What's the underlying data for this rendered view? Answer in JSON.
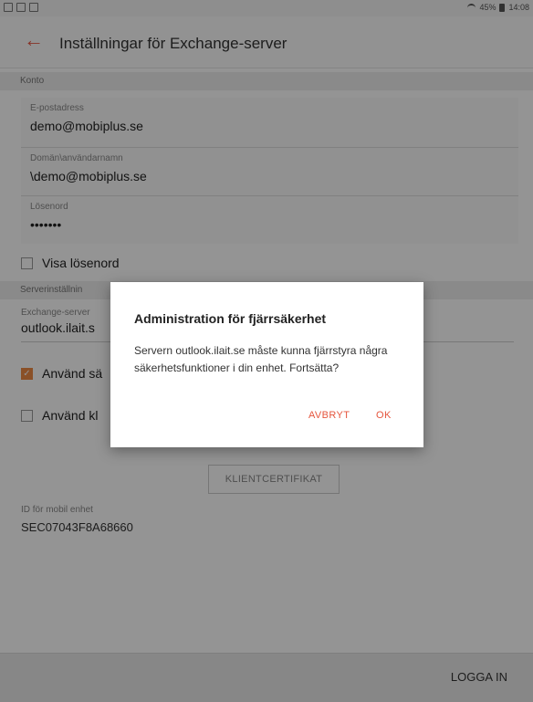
{
  "status_bar": {
    "right_text": "45%",
    "time": "14:08"
  },
  "app_bar": {
    "title": "Inställningar för Exchange-server"
  },
  "account": {
    "header": "Konto",
    "email": {
      "label": "E-postadress",
      "value": "demo@mobiplus.se"
    },
    "domain_user": {
      "label": "Domän\\användarnamn",
      "value": "\\demo@mobiplus.se"
    },
    "password": {
      "label": "Lösenord",
      "value": "•••••••"
    },
    "show_password_label": "Visa lösenord"
  },
  "server": {
    "header": "Serverinställnin",
    "exchange_label": "Exchange-server",
    "exchange_value": "outlook.ilait.s",
    "use_ssl_label": "Använd sä",
    "use_ssl_checked": true,
    "use_client_label": "Använd kl",
    "use_client_checked": false
  },
  "client_cert_button": "KLIENTCERTIFIKAT",
  "device_id": {
    "label": "ID för mobil enhet",
    "value": "SEC07043F8A68660"
  },
  "bottom": {
    "login_label": "LOGGA IN"
  },
  "dialog": {
    "title": "Administration för fjärrsäkerhet",
    "message": "Servern outlook.ilait.se måste kunna fjärrstyra några säkerhetsfunktioner i din enhet. Fortsätta?",
    "cancel_label": "AVBRYT",
    "ok_label": "OK"
  },
  "colors": {
    "accent": "#e85a45",
    "checkbox_checked": "#ee8a44"
  }
}
